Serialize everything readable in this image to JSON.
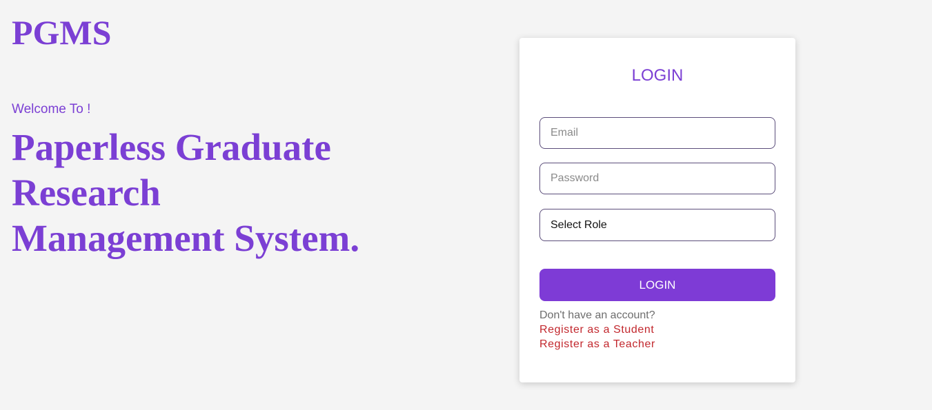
{
  "brand": {
    "title": "PGMS"
  },
  "hero": {
    "welcome": "Welcome To !",
    "headline_lines": [
      "Paperless Graduate",
      "Research",
      "Management System."
    ]
  },
  "login_card": {
    "title": "LOGIN",
    "email_placeholder": "Email",
    "password_placeholder": "Password",
    "role_select_value": "Select Role",
    "submit_label": "LOGIN",
    "no_account_text": "Don't have an account?",
    "register_student": "Register as a Student",
    "register_teacher": "Register as a Teacher"
  },
  "colors": {
    "background": "#f4f4f4",
    "brand_purple": "#7b3fd4",
    "button_purple": "#7e3bd6",
    "link_red": "#c2272d",
    "card": "#ffffff"
  }
}
